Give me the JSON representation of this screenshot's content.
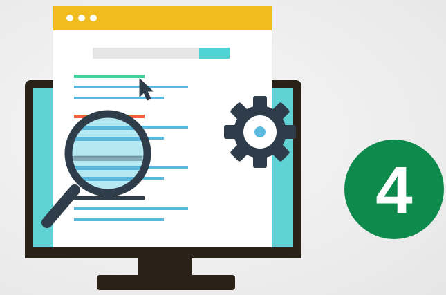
{
  "illustration": {
    "icons": [
      "monitor-icon",
      "browser-window-icon",
      "mouse-cursor-icon",
      "magnifying-glass-icon",
      "gear-icon"
    ],
    "colors": {
      "background": "#eeeeee",
      "monitor_frame": "#2a2118",
      "monitor_screen": "#5fd3d3",
      "browser_bar": "#f1bd1e",
      "browser_body": "#ffffff",
      "text_lines": "#5bb8dd",
      "highlight_green": "#3ed39a",
      "highlight_red": "#f0623e",
      "dark_accent": "#2f3d4a",
      "badge": "#0e8a4d"
    }
  },
  "step_badge": {
    "number": "4",
    "color": "#0e8a4d"
  }
}
